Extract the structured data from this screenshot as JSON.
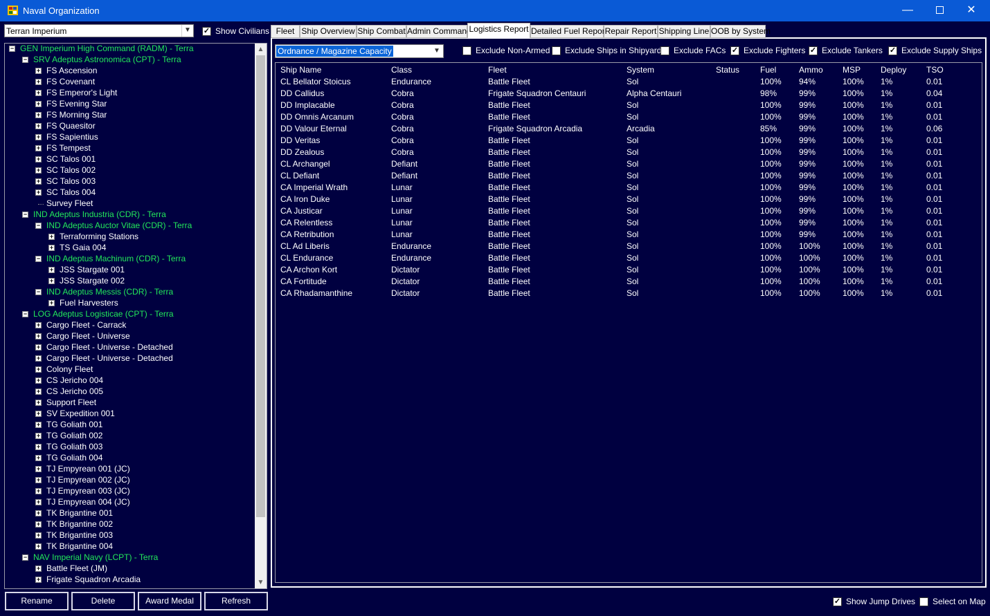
{
  "window": {
    "title": "Naval Organization"
  },
  "left": {
    "race": "Terran Imperium",
    "show_civilians": {
      "label": "Show Civilians",
      "checked": true
    },
    "tree": [
      {
        "text": "GEN Imperium High Command  (RADM)  -  Terra",
        "type": "cmd",
        "level": 0,
        "exp": "minus"
      },
      {
        "text": "SRV Adeptus Astronomica  (CPT)  -  Terra",
        "type": "cmd",
        "level": 1,
        "exp": "minus"
      },
      {
        "text": "FS Ascension",
        "type": "flt",
        "level": 2,
        "exp": "plus"
      },
      {
        "text": "FS Covenant",
        "type": "flt",
        "level": 2,
        "exp": "plus"
      },
      {
        "text": "FS Emperor's Light",
        "type": "flt",
        "level": 2,
        "exp": "plus"
      },
      {
        "text": "FS Evening Star",
        "type": "flt",
        "level": 2,
        "exp": "plus"
      },
      {
        "text": "FS Morning Star",
        "type": "flt",
        "level": 2,
        "exp": "plus"
      },
      {
        "text": "FS Quaesitor",
        "type": "flt",
        "level": 2,
        "exp": "plus"
      },
      {
        "text": "FS Sapientius",
        "type": "flt",
        "level": 2,
        "exp": "plus"
      },
      {
        "text": "FS Tempest",
        "type": "flt",
        "level": 2,
        "exp": "plus"
      },
      {
        "text": "SC Talos 001",
        "type": "flt",
        "level": 2,
        "exp": "plus"
      },
      {
        "text": "SC Talos 002",
        "type": "flt",
        "level": 2,
        "exp": "plus"
      },
      {
        "text": "SC Talos 003",
        "type": "flt",
        "level": 2,
        "exp": "plus"
      },
      {
        "text": "SC Talos 004",
        "type": "flt",
        "level": 2,
        "exp": "plus"
      },
      {
        "text": "Survey Fleet",
        "type": "flt",
        "level": 2,
        "exp": "none"
      },
      {
        "text": "IND Adeptus Industria  (CDR)  -  Terra",
        "type": "cmd",
        "level": 1,
        "exp": "minus"
      },
      {
        "text": "IND Adeptus Auctor Vitae  (CDR)  -  Terra",
        "type": "cmd",
        "level": 2,
        "exp": "minus"
      },
      {
        "text": "Terraforming Stations",
        "type": "flt",
        "level": 3,
        "exp": "plus"
      },
      {
        "text": "TS Gaia 004",
        "type": "flt",
        "level": 3,
        "exp": "plus"
      },
      {
        "text": "IND Adeptus Machinum  (CDR)  -  Terra",
        "type": "cmd",
        "level": 2,
        "exp": "minus"
      },
      {
        "text": "JSS Stargate 001",
        "type": "flt",
        "level": 3,
        "exp": "plus"
      },
      {
        "text": "JSS Stargate 002",
        "type": "flt",
        "level": 3,
        "exp": "plus"
      },
      {
        "text": "IND Adeptus Messis  (CDR)  -  Terra",
        "type": "cmd",
        "level": 2,
        "exp": "minus"
      },
      {
        "text": "Fuel Harvesters",
        "type": "flt",
        "level": 3,
        "exp": "plus"
      },
      {
        "text": "LOG Adeptus Logisticae  (CPT)  -  Terra",
        "type": "cmd",
        "level": 1,
        "exp": "minus"
      },
      {
        "text": "Cargo Fleet - Carrack",
        "type": "flt",
        "level": 2,
        "exp": "plus"
      },
      {
        "text": "Cargo Fleet - Universe",
        "type": "flt",
        "level": 2,
        "exp": "plus"
      },
      {
        "text": "Cargo Fleet - Universe - Detached",
        "type": "flt",
        "level": 2,
        "exp": "plus"
      },
      {
        "text": "Cargo Fleet - Universe - Detached",
        "type": "flt",
        "level": 2,
        "exp": "plus"
      },
      {
        "text": "Colony Fleet",
        "type": "flt",
        "level": 2,
        "exp": "plus"
      },
      {
        "text": "CS Jericho 004",
        "type": "flt",
        "level": 2,
        "exp": "plus"
      },
      {
        "text": "CS Jericho 005",
        "type": "flt",
        "level": 2,
        "exp": "plus"
      },
      {
        "text": "Support Fleet",
        "type": "flt",
        "level": 2,
        "exp": "plus"
      },
      {
        "text": "SV Expedition 001",
        "type": "flt",
        "level": 2,
        "exp": "plus"
      },
      {
        "text": "TG Goliath 001",
        "type": "flt",
        "level": 2,
        "exp": "plus"
      },
      {
        "text": "TG Goliath 002",
        "type": "flt",
        "level": 2,
        "exp": "plus"
      },
      {
        "text": "TG Goliath 003",
        "type": "flt",
        "level": 2,
        "exp": "plus"
      },
      {
        "text": "TG Goliath 004",
        "type": "flt",
        "level": 2,
        "exp": "plus"
      },
      {
        "text": "TJ Empyrean 001  (JC)",
        "type": "flt",
        "level": 2,
        "exp": "plus"
      },
      {
        "text": "TJ Empyrean 002  (JC)",
        "type": "flt",
        "level": 2,
        "exp": "plus"
      },
      {
        "text": "TJ Empyrean 003  (JC)",
        "type": "flt",
        "level": 2,
        "exp": "plus"
      },
      {
        "text": "TJ Empyrean 004  (JC)",
        "type": "flt",
        "level": 2,
        "exp": "plus"
      },
      {
        "text": "TK Brigantine 001",
        "type": "flt",
        "level": 2,
        "exp": "plus"
      },
      {
        "text": "TK Brigantine 002",
        "type": "flt",
        "level": 2,
        "exp": "plus"
      },
      {
        "text": "TK Brigantine 003",
        "type": "flt",
        "level": 2,
        "exp": "plus"
      },
      {
        "text": "TK Brigantine 004",
        "type": "flt",
        "level": 2,
        "exp": "plus"
      },
      {
        "text": "NAV Imperial Navy  (LCPT)  -  Terra",
        "type": "cmd",
        "level": 1,
        "exp": "minus"
      },
      {
        "text": "Battle Fleet  (JM)",
        "type": "flt",
        "level": 2,
        "exp": "plus"
      },
      {
        "text": "Frigate Squadron Arcadia",
        "type": "flt",
        "level": 2,
        "exp": "plus"
      }
    ],
    "buttons": [
      "Rename",
      "Delete",
      "Award Medal",
      "Refresh"
    ]
  },
  "tabs": [
    {
      "label": "Fleet",
      "active": false
    },
    {
      "label": "Ship Overview",
      "active": false
    },
    {
      "label": "Ship Combat",
      "active": false
    },
    {
      "label": "Admin Command",
      "active": false
    },
    {
      "label": "Logistics Report",
      "active": true
    },
    {
      "label": "Detailed Fuel Report",
      "active": false
    },
    {
      "label": "Repair Report",
      "active": false
    },
    {
      "label": "Shipping Line",
      "active": false
    },
    {
      "label": "OOB by System",
      "active": false
    }
  ],
  "report": {
    "type_selected": "Ordnance / Magazine Capacity",
    "filters": [
      {
        "label": "Exclude Non-Armed",
        "checked": false
      },
      {
        "label": "Exclude Ships in Shipyard",
        "checked": false
      },
      {
        "label": "Exclude FACs",
        "checked": false
      },
      {
        "label": "Exclude Fighters",
        "checked": true
      },
      {
        "label": "Exclude Tankers",
        "checked": true
      },
      {
        "label": "Exclude Supply Ships",
        "checked": true
      }
    ],
    "columns": [
      "Ship Name",
      "Class",
      "Fleet",
      "System",
      "Status",
      "Fuel",
      "Ammo",
      "MSP",
      "Deploy",
      "TSO"
    ],
    "rows": [
      [
        "CL Bellator Stoicus",
        "Endurance",
        "Battle Fleet",
        "Sol",
        "",
        "100%",
        "94%",
        "100%",
        "1%",
        "0.01"
      ],
      [
        "DD Callidus",
        "Cobra",
        "Frigate Squadron Centauri",
        "Alpha Centauri",
        "",
        "98%",
        "99%",
        "100%",
        "1%",
        "0.04"
      ],
      [
        "DD Implacable",
        "Cobra",
        "Battle Fleet",
        "Sol",
        "",
        "100%",
        "99%",
        "100%",
        "1%",
        "0.01"
      ],
      [
        "DD Omnis Arcanum",
        "Cobra",
        "Battle Fleet",
        "Sol",
        "",
        "100%",
        "99%",
        "100%",
        "1%",
        "0.01"
      ],
      [
        "DD Valour Eternal",
        "Cobra",
        "Frigate Squadron Arcadia",
        "Arcadia",
        "",
        "85%",
        "99%",
        "100%",
        "1%",
        "0.06"
      ],
      [
        "DD Veritas",
        "Cobra",
        "Battle Fleet",
        "Sol",
        "",
        "100%",
        "99%",
        "100%",
        "1%",
        "0.01"
      ],
      [
        "DD Zealous",
        "Cobra",
        "Battle Fleet",
        "Sol",
        "",
        "100%",
        "99%",
        "100%",
        "1%",
        "0.01"
      ],
      [
        "CL Archangel",
        "Defiant",
        "Battle Fleet",
        "Sol",
        "",
        "100%",
        "99%",
        "100%",
        "1%",
        "0.01"
      ],
      [
        "CL Defiant",
        "Defiant",
        "Battle Fleet",
        "Sol",
        "",
        "100%",
        "99%",
        "100%",
        "1%",
        "0.01"
      ],
      [
        "CA Imperial Wrath",
        "Lunar",
        "Battle Fleet",
        "Sol",
        "",
        "100%",
        "99%",
        "100%",
        "1%",
        "0.01"
      ],
      [
        "CA Iron Duke",
        "Lunar",
        "Battle Fleet",
        "Sol",
        "",
        "100%",
        "99%",
        "100%",
        "1%",
        "0.01"
      ],
      [
        "CA Justicar",
        "Lunar",
        "Battle Fleet",
        "Sol",
        "",
        "100%",
        "99%",
        "100%",
        "1%",
        "0.01"
      ],
      [
        "CA Relentless",
        "Lunar",
        "Battle Fleet",
        "Sol",
        "",
        "100%",
        "99%",
        "100%",
        "1%",
        "0.01"
      ],
      [
        "CA Retribution",
        "Lunar",
        "Battle Fleet",
        "Sol",
        "",
        "100%",
        "99%",
        "100%",
        "1%",
        "0.01"
      ],
      [
        "CL Ad Liberis",
        "Endurance",
        "Battle Fleet",
        "Sol",
        "",
        "100%",
        "100%",
        "100%",
        "1%",
        "0.01"
      ],
      [
        "CL Endurance",
        "Endurance",
        "Battle Fleet",
        "Sol",
        "",
        "100%",
        "100%",
        "100%",
        "1%",
        "0.01"
      ],
      [
        "CA Archon Kort",
        "Dictator",
        "Battle Fleet",
        "Sol",
        "",
        "100%",
        "100%",
        "100%",
        "1%",
        "0.01"
      ],
      [
        "CA Fortitude",
        "Dictator",
        "Battle Fleet",
        "Sol",
        "",
        "100%",
        "100%",
        "100%",
        "1%",
        "0.01"
      ],
      [
        "CA Rhadamanthine",
        "Dictator",
        "Battle Fleet",
        "Sol",
        "",
        "100%",
        "100%",
        "100%",
        "1%",
        "0.01"
      ]
    ]
  },
  "bottom": {
    "show_jump_drives": {
      "label": "Show Jump Drives",
      "checked": true
    },
    "select_on_map": {
      "label": "Select on Map",
      "checked": false
    }
  }
}
